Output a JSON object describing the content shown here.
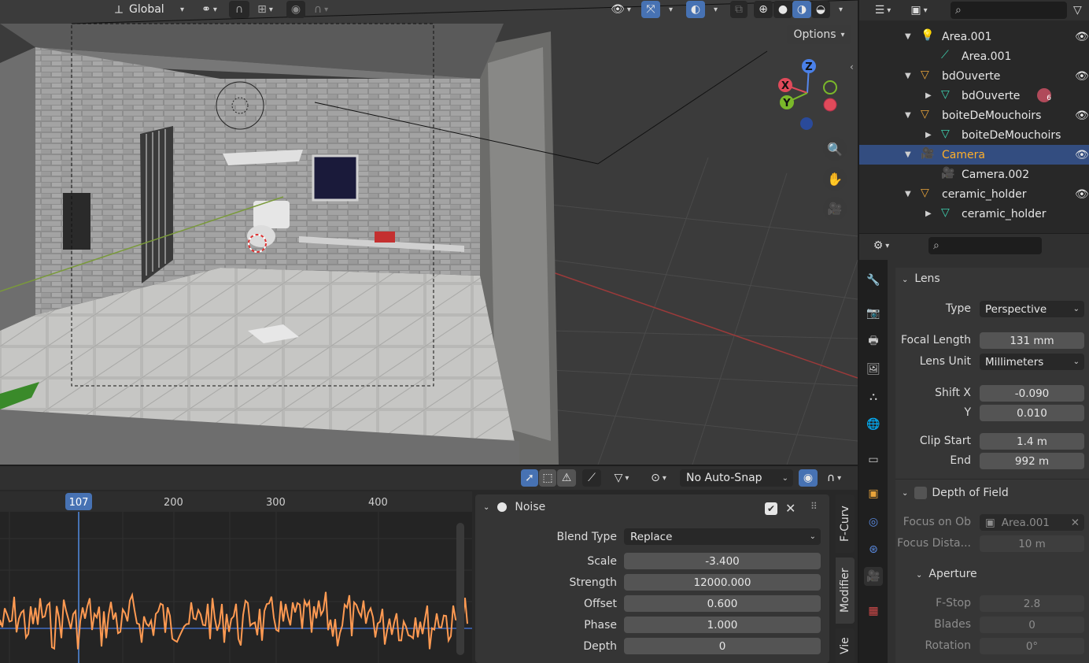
{
  "viewport": {
    "transform_orientation": "Global",
    "options_label": "Options",
    "gizmo_axes": [
      "X",
      "Y",
      "Z"
    ]
  },
  "outliner": {
    "rows": [
      {
        "label": "Area.001",
        "depth": 0,
        "icon": "light-icon",
        "expanded": true,
        "eye": true
      },
      {
        "label": "Area.001",
        "depth": 1,
        "icon": "light-data-icon"
      },
      {
        "label": "bdOuverte",
        "depth": 0,
        "icon": "object-icon",
        "expanded": true,
        "eye": true
      },
      {
        "label": "bdOuverte",
        "depth": 1,
        "icon": "mesh-icon",
        "collapsed": true,
        "badge": "6"
      },
      {
        "label": "boiteDeMouchoirs",
        "depth": 0,
        "icon": "object-icon",
        "expanded": true,
        "eye": true
      },
      {
        "label": "boiteDeMouchoirs",
        "depth": 1,
        "icon": "mesh-icon",
        "collapsed": true
      },
      {
        "label": "Camera",
        "depth": 0,
        "icon": "camera-object-icon",
        "expanded": true,
        "eye": true,
        "selected": true
      },
      {
        "label": "Camera.002",
        "depth": 1,
        "icon": "camera-data-icon"
      },
      {
        "label": "ceramic_holder",
        "depth": 0,
        "icon": "object-icon",
        "expanded": true,
        "eye": true
      },
      {
        "label": "ceramic_holder",
        "depth": 1,
        "icon": "mesh-icon",
        "collapsed": true
      }
    ]
  },
  "properties": {
    "lens_panel": "Lens",
    "type_label": "Type",
    "type_value": "Perspective",
    "focal_label": "Focal Length",
    "focal_value": "131 mm",
    "lens_unit_label": "Lens Unit",
    "lens_unit_value": "Millimeters",
    "shift_x_label": "Shift X",
    "shift_x_value": "-0.090",
    "shift_y_label": "Y",
    "shift_y_value": "0.010",
    "clip_start_label": "Clip Start",
    "clip_start_value": "1.4 m",
    "clip_end_label": "End",
    "clip_end_value": "992 m",
    "dof_panel": "Depth of Field",
    "focus_obj_label": "Focus on Ob",
    "focus_obj_value": "Area.001",
    "focus_dist_label": "Focus Dista...",
    "focus_dist_value": "10 m",
    "aperture_panel": "Aperture",
    "fstop_label": "F-Stop",
    "fstop_value": "2.8",
    "blades_label": "Blades",
    "blades_value": "0",
    "rotation_label": "Rotation",
    "rotation_value": "0°"
  },
  "graph_editor": {
    "snap_label": "No Auto-Snap",
    "current_frame": "107",
    "frame_ticks": [
      "1",
      "200",
      "300",
      "400"
    ],
    "side_tabs": [
      "F-Curv",
      "Modifier",
      "Vie"
    ]
  },
  "modifier": {
    "name": "Noise",
    "blend_type_label": "Blend Type",
    "blend_type_value": "Replace",
    "scale_label": "Scale",
    "scale_value": "-3.400",
    "strength_label": "Strength",
    "strength_value": "12000.000",
    "offset_label": "Offset",
    "offset_value": "0.600",
    "phase_label": "Phase",
    "phase_value": "1.000",
    "depth_label": "Depth",
    "depth_value": "0"
  },
  "colors": {
    "accent": "#4772b3",
    "selected_row": "#334d80",
    "selected_text": "#ffaf29",
    "curve": "#ff9a52",
    "object_icon": "#e8a33a",
    "mesh_icon": "#3fd3b1"
  }
}
